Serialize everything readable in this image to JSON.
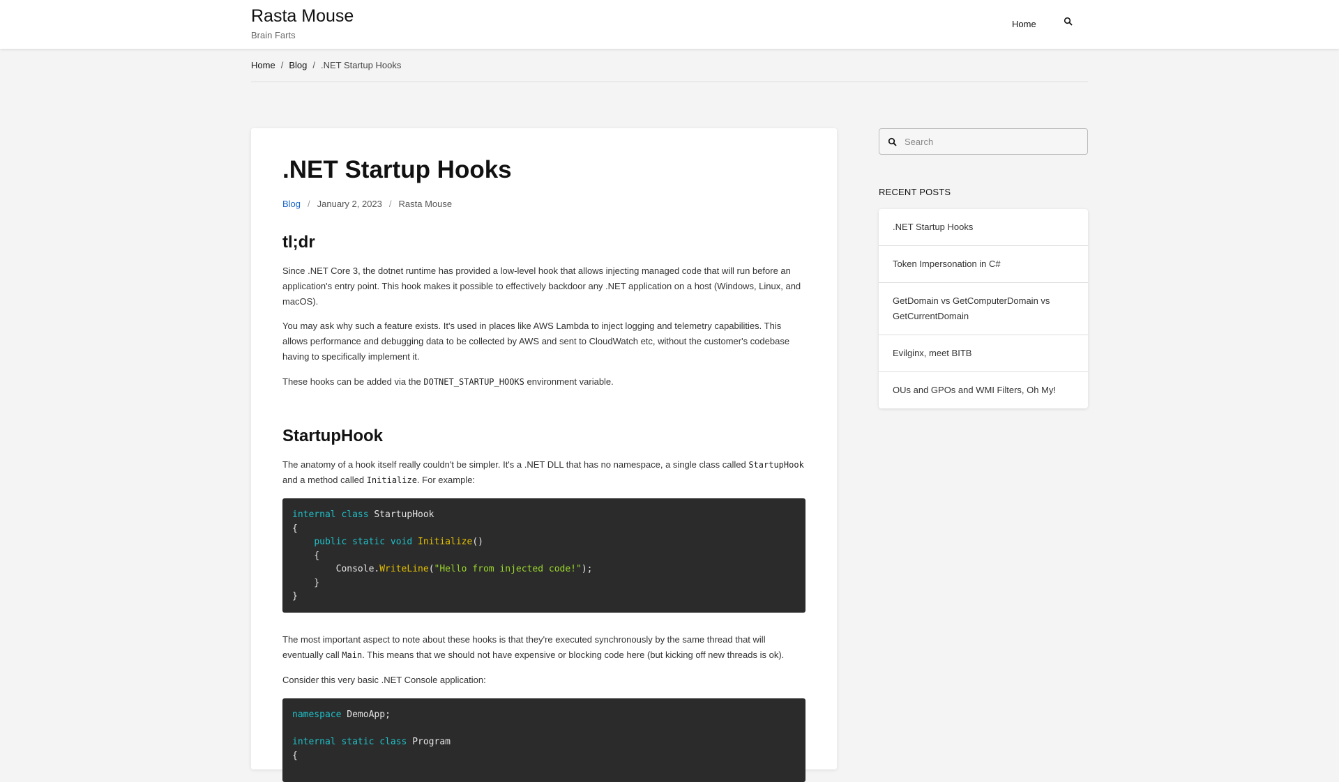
{
  "header": {
    "site_title": "Rasta Mouse",
    "tagline": "Brain Farts",
    "nav": {
      "home_label": "Home",
      "search_icon": "search-icon"
    }
  },
  "breadcrumb": {
    "items": [
      "Home",
      "Blog",
      ".NET Startup Hooks"
    ],
    "separator": "/"
  },
  "post": {
    "title": ".NET Startup Hooks",
    "meta": {
      "category": "Blog",
      "date": "January 2, 2023",
      "author": "Rasta Mouse",
      "separator": "/"
    },
    "sections": {
      "tldr": {
        "heading": "tl;dr",
        "p1": "Since .NET Core 3, the dotnet runtime has provided a low-level hook that allows injecting managed code that will run before an application's entry point. This hook makes it possible to effectively backdoor any .NET application on a host (Windows, Linux, and macOS).",
        "p2": "You may ask why such a feature exists. It's used in places like AWS Lambda to inject logging and telemetry capabilities. This allows performance and debugging data to be collected by AWS and sent to CloudWatch etc, without the customer's codebase having to specifically implement it.",
        "p3_before": "These hooks can be added via the ",
        "p3_code": "DOTNET_STARTUP_HOOKS",
        "p3_after": " environment variable."
      },
      "startuphook": {
        "heading": "StartupHook",
        "p1_before": "The anatomy of a hook itself really couldn't be simpler. It's a .NET DLL that has no namespace, a single class called ",
        "p1_code1": "StartupHook",
        "p1_mid": " and a method called ",
        "p1_code2": "Initialize",
        "p1_after": ". For example:",
        "code1": {
          "l1_kw": "internal class",
          "l1_name": " StartupHook",
          "l2": "{",
          "l3_indent": "    ",
          "l3_kw": "public static void",
          "l3_fn": "Initialize",
          "l3_rest": "()",
          "l4": "    {",
          "l5_pre": "        Console.",
          "l5_fn": "WriteLine",
          "l5_open": "(",
          "l5_str": "\"Hello from injected code!\"",
          "l5_close": ");",
          "l6": "    }",
          "l7": "}"
        },
        "p2_before": "The most important aspect to note about these hooks is that they're executed synchronously by the same thread that will eventually call ",
        "p2_code": "Main",
        "p2_after": ". This means that we should not have expensive or blocking code here (but kicking off new threads is ok).",
        "p3": "Consider this very basic .NET Console application:",
        "code2": {
          "l1_kw": "namespace",
          "l1_rest": " DemoApp;",
          "l3_kw": "internal static class",
          "l3_rest": " Program",
          "l4": "{"
        }
      }
    }
  },
  "sidebar": {
    "search_placeholder": "Search",
    "recent_title": "RECENT POSTS",
    "recent_posts": [
      ".NET Startup Hooks",
      "Token Impersonation in C#",
      "GetDomain vs GetComputerDomain vs GetCurrentDomain",
      "Evilginx, meet BITB",
      "OUs and GPOs and WMI Filters, Oh My!"
    ]
  }
}
